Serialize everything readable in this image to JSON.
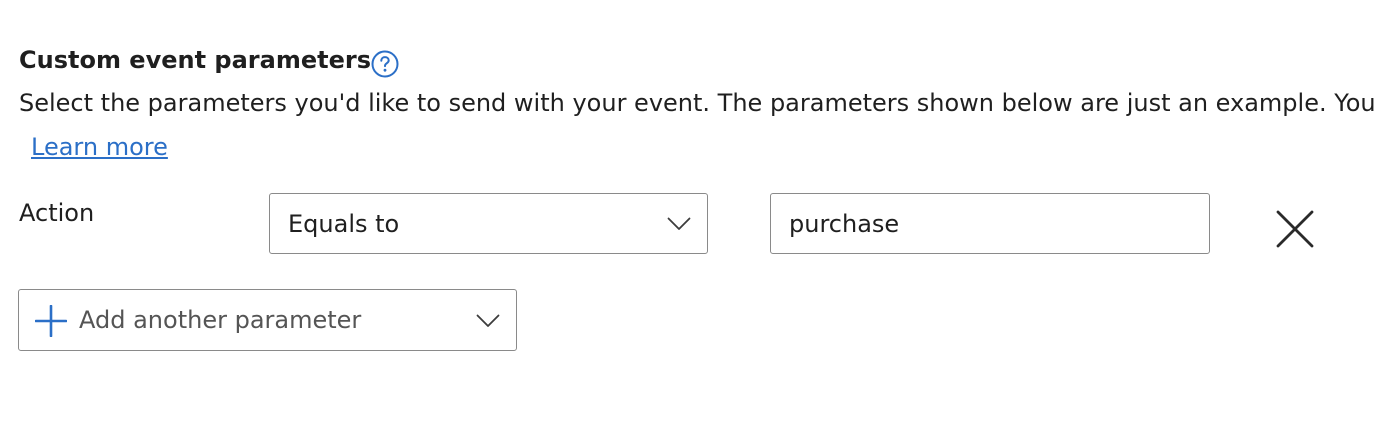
{
  "section": {
    "title": "Custom event parameters",
    "help_icon": "question-circle-icon",
    "description": "Select the parameters you'd like to send with your event. The parameters shown below are just an example. You",
    "learn_more": "Learn more"
  },
  "parameter_row": {
    "label": "Action",
    "operator": {
      "selected": "Equals to",
      "icon": "chevron-down-icon"
    },
    "value": "purchase",
    "remove_icon": "close-icon"
  },
  "add_parameter": {
    "label": "Add another parameter",
    "icon": "plus-icon",
    "dropdown_icon": "chevron-down-icon"
  },
  "colors": {
    "accent": "#2b6fc7",
    "text": "#1f1f1f",
    "border": "#8a8a8a",
    "muted_text": "#555555"
  }
}
